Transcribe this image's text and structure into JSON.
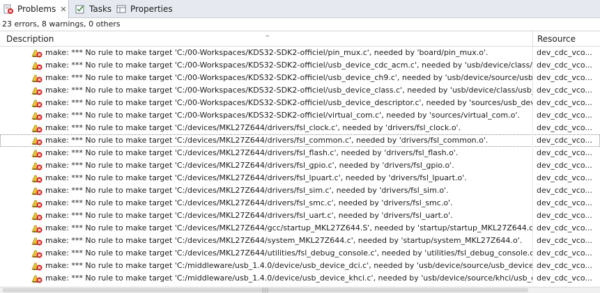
{
  "tabs": [
    {
      "label": "Problems",
      "icon": "problems-icon",
      "active": true
    },
    {
      "label": "Tasks",
      "icon": "tasks-icon",
      "active": false
    },
    {
      "label": "Properties",
      "icon": "properties-icon",
      "active": false
    }
  ],
  "summary": "23 errors, 8 warnings, 0 others",
  "columns": {
    "description": "Description",
    "resource": "Resource"
  },
  "rows": [
    {
      "desc": "make: *** No rule to make target 'C:/00-Workspaces/KDS32-SDK2-officiel/pin_mux.c', needed by 'board/pin_mux.o'.",
      "res": "dev_cdc_vco..."
    },
    {
      "desc": "make: *** No rule to make target 'C:/00-Workspaces/KDS32-SDK2-officiel/usb_device_cdc_acm.c', needed by 'usb/device/class/cdc/usb",
      "res": "dev_cdc_vco..."
    },
    {
      "desc": "make: *** No rule to make target 'C:/00-Workspaces/KDS32-SDK2-officiel/usb_device_ch9.c', needed by 'usb/device/source/usb_device_c",
      "res": "dev_cdc_vco..."
    },
    {
      "desc": "make: *** No rule to make target 'C:/00-Workspaces/KDS32-SDK2-officiel/usb_device_class.c', needed by 'usb/device/class/usb_devic",
      "res": "dev_cdc_vco..."
    },
    {
      "desc": "make: *** No rule to make target 'C:/00-Workspaces/KDS32-SDK2-officiel/usb_device_descriptor.c', needed by 'sources/usb_device_d",
      "res": "dev_cdc_vco..."
    },
    {
      "desc": "make: *** No rule to make target 'C:/00-Workspaces/KDS32-SDK2-officiel/virtual_com.c', needed by 'sources/virtual_com.o'.",
      "res": "dev_cdc_vco..."
    },
    {
      "desc": "make: *** No rule to make target 'C:/devices/MKL27Z644/drivers/fsl_clock.c', needed by 'drivers/fsl_clock.o'.",
      "res": "dev_cdc_vco..."
    },
    {
      "desc": "make: *** No rule to make target 'C:/devices/MKL27Z644/drivers/fsl_common.c', needed by 'drivers/fsl_common.o'.",
      "res": "dev_cdc_vco..."
    },
    {
      "desc": "make: *** No rule to make target 'C:/devices/MKL27Z644/drivers/fsl_flash.c', needed by 'drivers/fsl_flash.o'.",
      "res": "dev_cdc_vco..."
    },
    {
      "desc": "make: *** No rule to make target 'C:/devices/MKL27Z644/drivers/fsl_gpio.c', needed by 'drivers/fsl_gpio.o'.",
      "res": "dev_cdc_vco..."
    },
    {
      "desc": "make: *** No rule to make target 'C:/devices/MKL27Z644/drivers/fsl_lpuart.c', needed by 'drivers/fsl_lpuart.o'.",
      "res": "dev_cdc_vco..."
    },
    {
      "desc": "make: *** No rule to make target 'C:/devices/MKL27Z644/drivers/fsl_sim.c', needed by 'drivers/fsl_sim.o'.",
      "res": "dev_cdc_vco..."
    },
    {
      "desc": "make: *** No rule to make target 'C:/devices/MKL27Z644/drivers/fsl_smc.c', needed by 'drivers/fsl_smc.o'.",
      "res": "dev_cdc_vco..."
    },
    {
      "desc": "make: *** No rule to make target 'C:/devices/MKL27Z644/drivers/fsl_uart.c', needed by 'drivers/fsl_uart.o'.",
      "res": "dev_cdc_vco..."
    },
    {
      "desc": "make: *** No rule to make target 'C:/devices/MKL27Z644/gcc/startup_MKL27Z644.S', needed by 'startup/startup_MKL27Z644.o'.",
      "res": "dev_cdc_vco..."
    },
    {
      "desc": "make: *** No rule to make target 'C:/devices/MKL27Z644/system_MKL27Z644.c', needed by 'startup/system_MKL27Z644.o'.",
      "res": "dev_cdc_vco..."
    },
    {
      "desc": "make: *** No rule to make target 'C:/devices/MKL27Z644/utilities/fsl_debug_console.c', needed by 'utilities/fsl_debug_console.o'.",
      "res": "dev_cdc_vco..."
    },
    {
      "desc": "make: *** No rule to make target 'C:/middleware/usb_1.4.0/device/usb_device_dci.c', needed by 'usb/device/source/usb_device_dci.o",
      "res": "dev_cdc_vco..."
    },
    {
      "desc": "make: *** No rule to make target 'C:/middleware/usb_1.4.0/device/usb_device_khci.c', needed by 'usb/device/source/khci/usb_devic",
      "res": "dev_cdc_vco..."
    }
  ],
  "selected_row": 7,
  "colors": {
    "error_red": "#d81e1e",
    "warning_yellow": "#e8c437",
    "tab_bg": "#e6eaf0"
  }
}
